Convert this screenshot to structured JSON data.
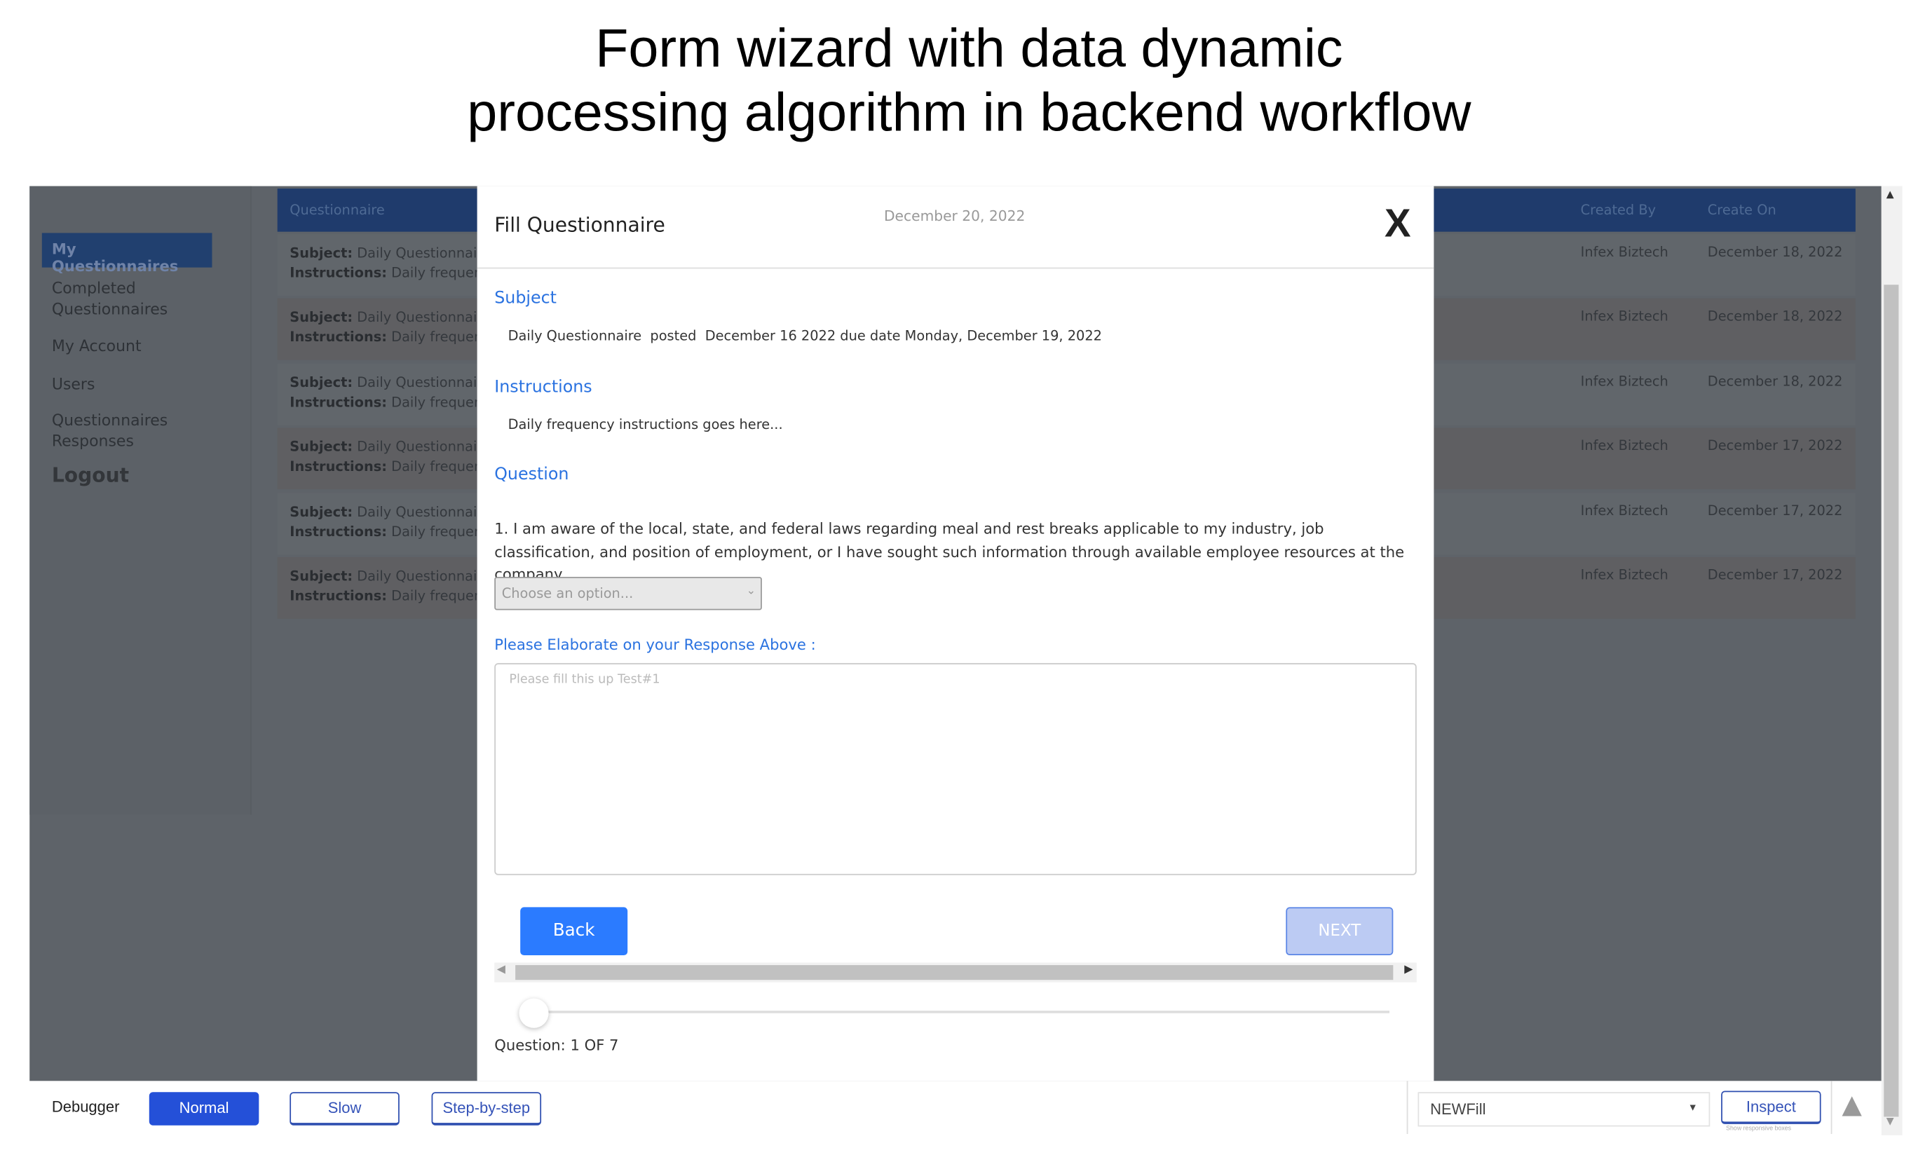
{
  "caption": {
    "line1": "Form wizard with data dynamic",
    "line2": "processing algorithm in backend workflow"
  },
  "sidebar": {
    "items": [
      {
        "label": "My Questionnaires",
        "active": true
      },
      {
        "label": "Completed Questionnaires"
      },
      {
        "label": "My Account"
      },
      {
        "label": "Users"
      },
      {
        "label": "Questionnaires Responses"
      },
      {
        "label": "Logout"
      }
    ]
  },
  "table": {
    "headers": {
      "questionnaire": "Questionnaire",
      "created_by": "Created By",
      "create_on": "Create On"
    },
    "subject_label": "Subject:",
    "instructions_label": "Instructions:",
    "rows": [
      {
        "subject": "Daily Questionnaire",
        "instructions": "Daily frequenc",
        "created_by": "Infex Biztech",
        "create_on": "December 18, 2022"
      },
      {
        "subject": "Daily Questionnaire",
        "instructions": "Daily frequenc",
        "created_by": "Infex Biztech",
        "create_on": "December 18, 2022"
      },
      {
        "subject": "Daily Questionnaire",
        "instructions": "Daily frequenc",
        "created_by": "Infex Biztech",
        "create_on": "December 18, 2022"
      },
      {
        "subject": "Daily Questionnaire",
        "instructions": "Daily frequenc",
        "created_by": "Infex Biztech",
        "create_on": "December 17, 2022"
      },
      {
        "subject": "Daily Questionnaire",
        "instructions": "Daily frequenc",
        "created_by": "Infex Biztech",
        "create_on": "December 17, 2022"
      },
      {
        "subject": "Daily Questionnaire",
        "instructions": "Daily frequenc",
        "created_by": "Infex Biztech",
        "create_on": "December 17, 2022"
      }
    ]
  },
  "modal": {
    "title": "Fill Questionnaire",
    "date": "December 20, 2022",
    "close_label": "X",
    "subject_heading": "Subject",
    "subject_text": "Daily Questionnaire  posted  December 16 2022 due date Monday, December 19, 2022",
    "instructions_heading": "Instructions",
    "instructions_text": "Daily frequency instructions goes here...",
    "question_heading": "Question",
    "question_text": "1. I am aware of the local, state, and federal laws regarding meal and rest breaks applicable to my industry, job classification, and position of employment, or I have sought such information through available employee resources at the company.",
    "select_placeholder": "Choose an option...",
    "elaborate_label": "Please Elaborate on your Response Above :",
    "textarea_placeholder": "Please fill this up Test#1",
    "back_label": "Back",
    "next_label": "NEXT",
    "progress_value": 1,
    "progress_max": 7,
    "progress_text": "Question: 1 OF 7"
  },
  "debugger": {
    "label": "Debugger",
    "normal": "Normal",
    "slow": "Slow",
    "step": "Step-by-step",
    "page_select": "NEWFill",
    "inspect": "Inspect",
    "inspect_hint": "Show responsive boxes"
  },
  "colors": {
    "accent": "#2a72e0",
    "header": "#1f3b6c",
    "debug_active": "#2450d8",
    "next_disabled": "#bccbf3"
  }
}
